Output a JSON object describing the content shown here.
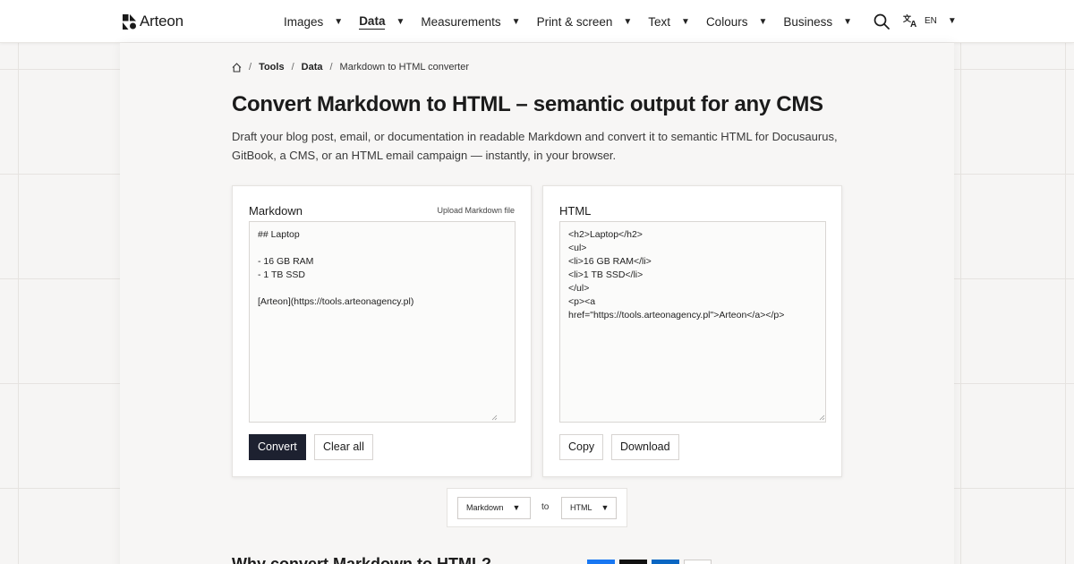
{
  "header": {
    "logo_text": "Arteon",
    "nav": [
      {
        "label": "Images"
      },
      {
        "label": "Data"
      },
      {
        "label": "Measurements"
      },
      {
        "label": "Print & screen"
      },
      {
        "label": "Text"
      },
      {
        "label": "Colours"
      },
      {
        "label": "Business"
      }
    ],
    "active_nav": "Data",
    "language": "EN"
  },
  "breadcrumb": {
    "items": [
      "Tools",
      "Data",
      "Markdown to HTML converter"
    ]
  },
  "page": {
    "title": "Convert Markdown to HTML – semantic output for any CMS",
    "lead": "Draft your blog post, email, or documentation in readable Markdown and convert it to semantic HTML for Docusaurus, GitBook, a CMS, or an HTML email campaign — instantly, in your browser."
  },
  "markdown_panel": {
    "title": "Markdown",
    "upload_label": "Upload Markdown file",
    "content": "## Laptop\n\n- 16 GB RAM\n- 1 TB SSD\n\n[Arteon](https://tools.arteonagency.pl)",
    "convert_label": "Convert",
    "clear_label": "Clear all"
  },
  "html_panel": {
    "title": "HTML",
    "content": "<h2>Laptop</h2>\n<ul>\n<li>16 GB RAM</li>\n<li>1 TB SSD</li>\n</ul>\n<p><a\nhref=\"https://tools.arteonagency.pl\">Arteon</a></p>",
    "copy_label": "Copy",
    "download_label": "Download"
  },
  "format_switcher": {
    "from": "Markdown",
    "to_label": "to",
    "to": "HTML"
  },
  "bottom": {
    "heading": "Why convert Markdown to HTML?"
  },
  "colors": {
    "primary_button": "#1d2130",
    "share_blue": "#1877f2",
    "share_black": "#111111",
    "share_linkedin": "#0a66c2"
  },
  "icons": {
    "home": "home-icon",
    "search": "search-icon",
    "translate": "translate-icon",
    "caret": "caret-down-icon"
  }
}
